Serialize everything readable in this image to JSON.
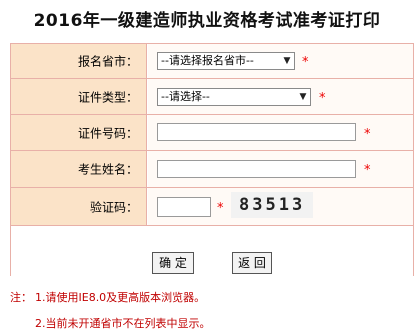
{
  "page": {
    "title": "2016年一级建造师执业资格考试准考证打印"
  },
  "form": {
    "province_label": "报名省市：",
    "province_value": "--请选择报名省市--",
    "id_type_label": "证件类型：",
    "id_type_value": "--请选择--",
    "id_number_label": "证件号码：",
    "id_number_value": "",
    "name_label": "考生姓名：",
    "name_value": "",
    "captcha_label": "验证码：",
    "captcha_value": "",
    "captcha_text": "83513",
    "required_mark": "*"
  },
  "buttons": {
    "confirm": "确 定",
    "back": "返 回"
  },
  "notes": {
    "prefix": "注：",
    "line1": "1.请使用IE8.0及更高版本浏览器。",
    "line2": "2.当前未开通省市不在列表中显示。"
  },
  "colors": {
    "label_bg": "#fbe3c8",
    "border": "#e8b0a8",
    "note": "#c00000",
    "required": "#e00000"
  },
  "icons": {
    "dropdown": "chevron-down-icon"
  }
}
